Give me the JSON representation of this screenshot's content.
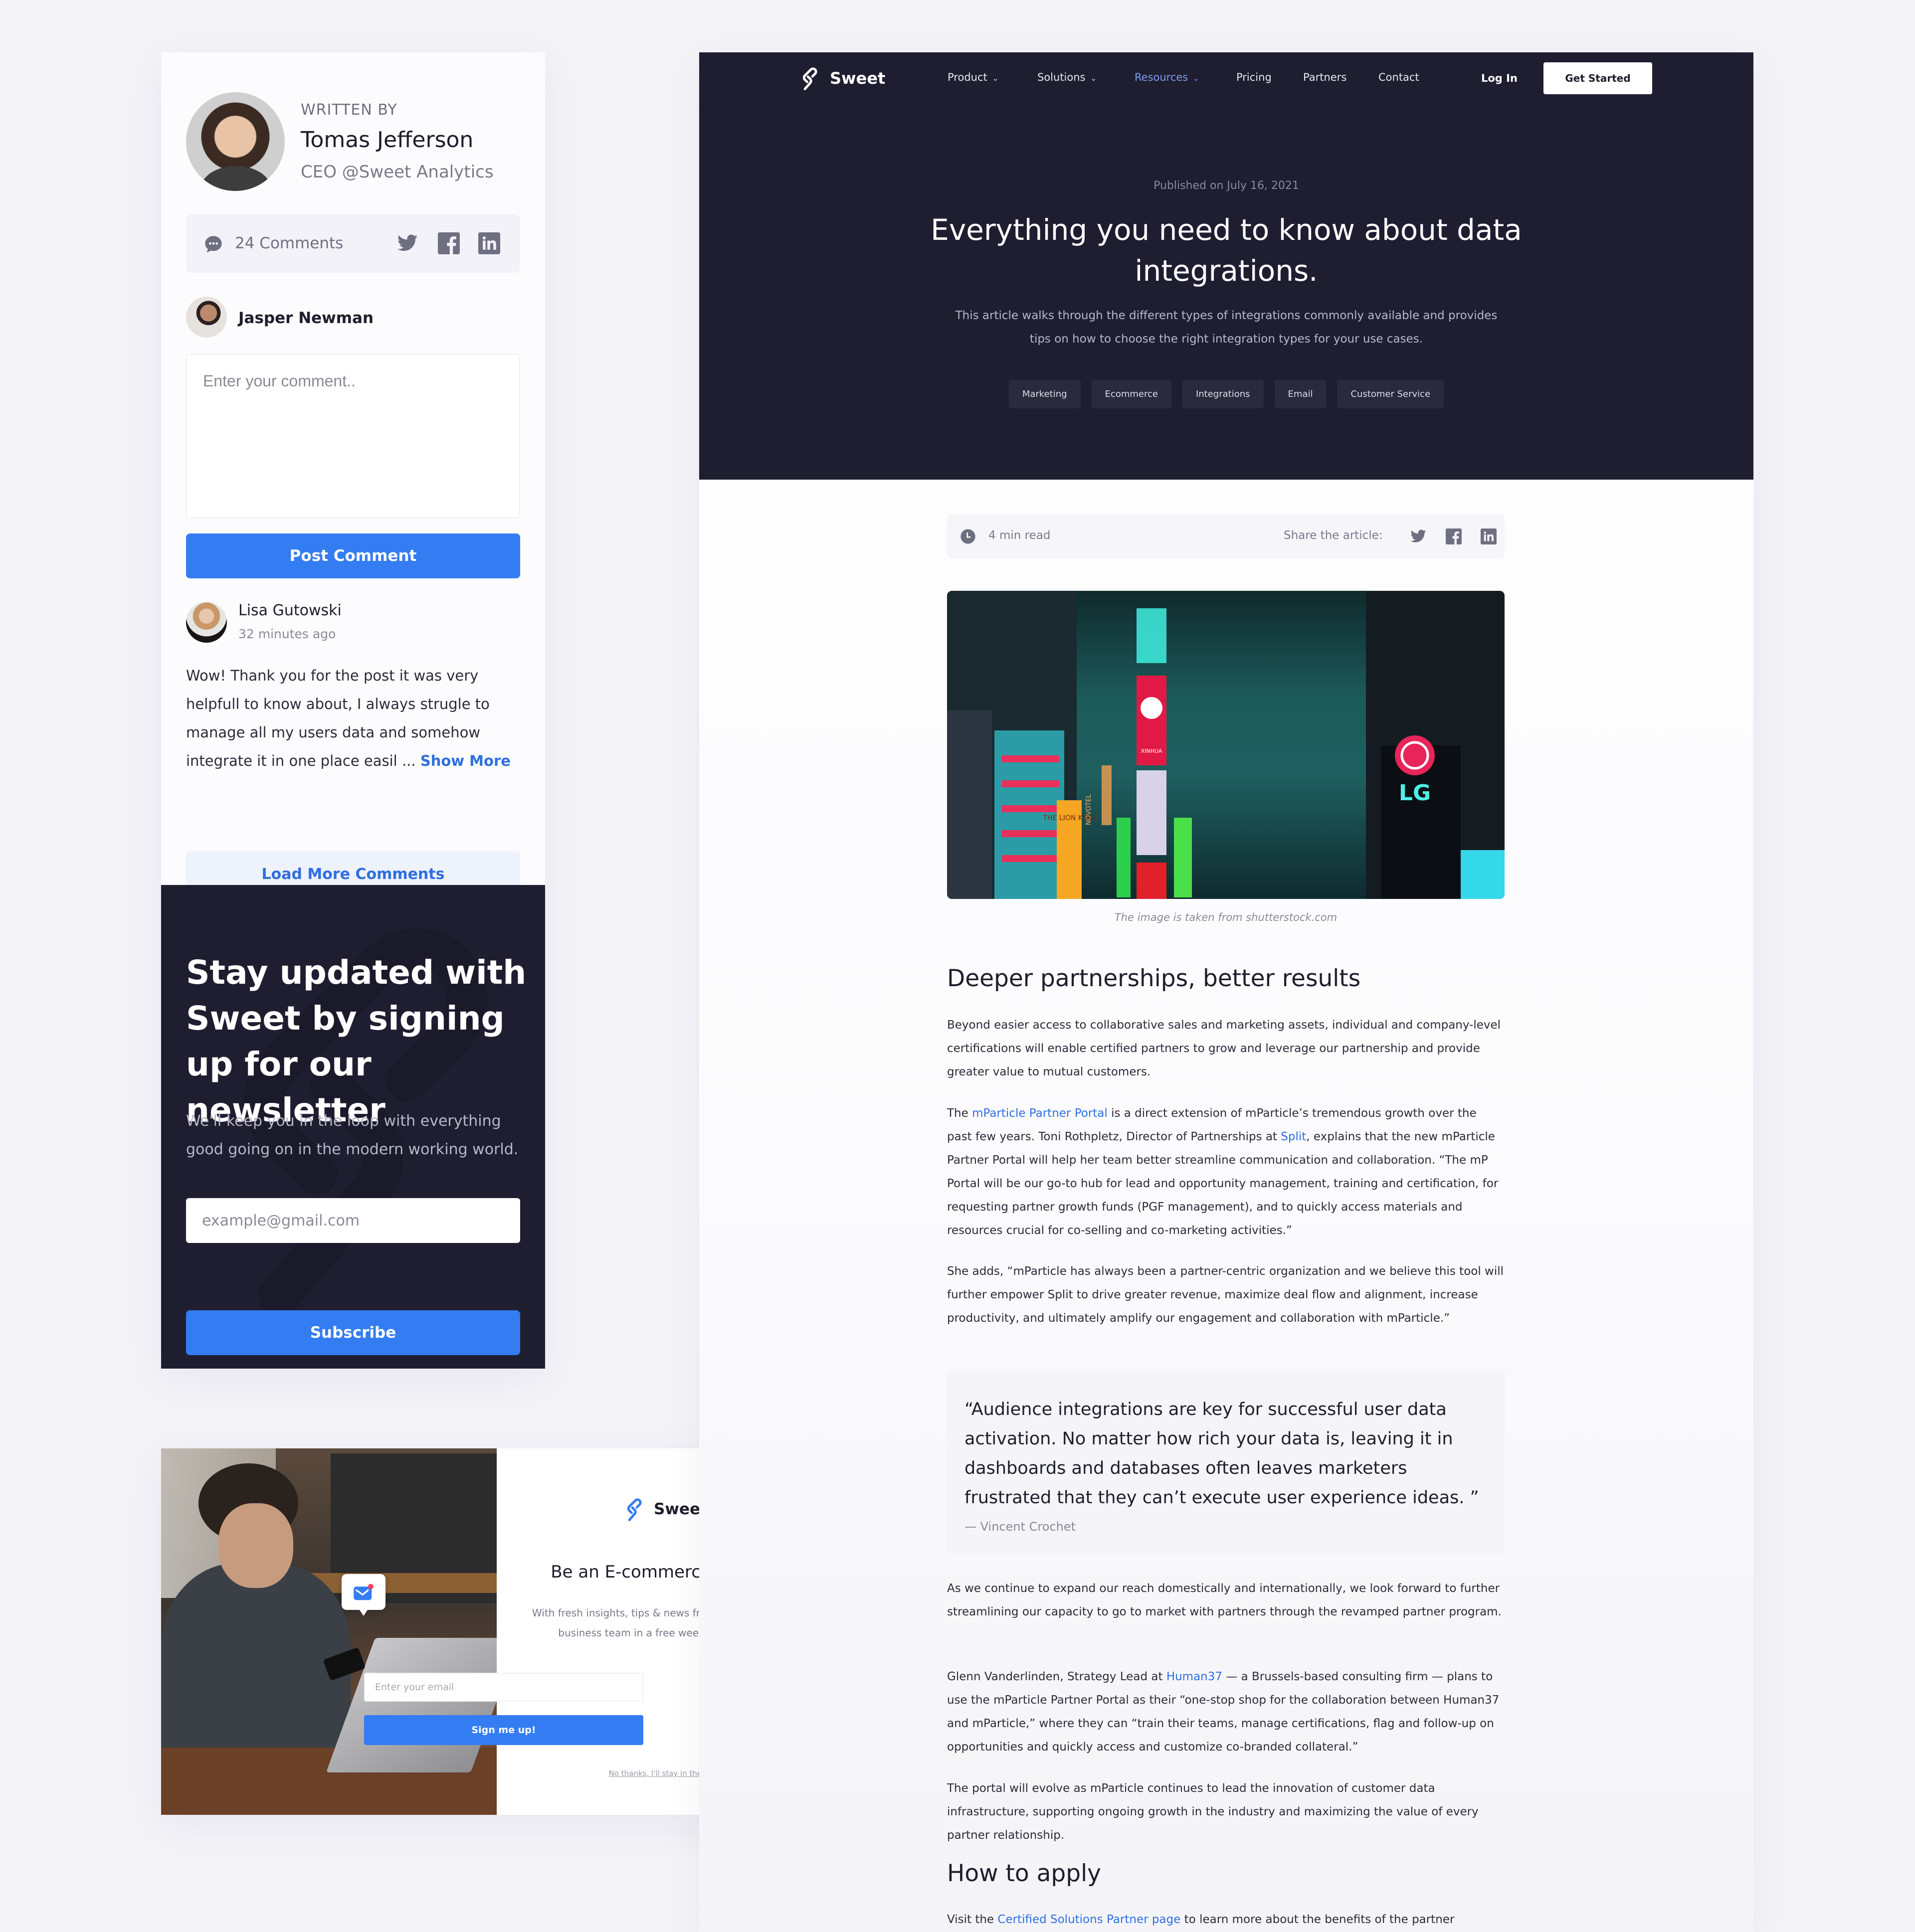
{
  "author_card": {
    "written_by_label": "WRITTEN BY",
    "name": "Tomas Jefferson",
    "role": "CEO @Sweet Analytics",
    "comments_count_label": "24 Comments",
    "social_icons": [
      "twitter-icon",
      "facebook-icon",
      "linkedin-icon"
    ]
  },
  "comment_form": {
    "current_user": "Jasper Newman",
    "placeholder": "Enter your comment..",
    "value": "",
    "submit_label": "Post Comment"
  },
  "comments": [
    {
      "author": "Lisa Gutowski",
      "time": "32 minutes ago",
      "text": "Wow! Thank you for the post it was very helpfull to know about, I always strugle to manage all my users data and somehow integrate it in one place easil ...",
      "show_more_label": "Show More"
    }
  ],
  "load_more_label": "Load More Comments",
  "newsletter": {
    "title": "Stay updated with Sweet by signing up for our newsletter",
    "description": "We'll keep you in the loop with everything good going on in the modern working world.",
    "email_placeholder": "example@gmail.com",
    "email_value": "",
    "button_label": "Subscribe"
  },
  "popup": {
    "close_label": "×",
    "brand": "Sweet",
    "title": "Be an E-commerce Expert!",
    "description": "With fresh insights, tips & news from our ecommerce business team in a free weekly newsletter.",
    "email_placeholder": "Enter your email",
    "email_value": "",
    "button_label": "Sign me up!",
    "decline_label": "No thanks, I'll stay in the dark"
  },
  "nav": {
    "brand": "Sweet",
    "items": [
      {
        "label": "Product",
        "has_dropdown": true,
        "active": false
      },
      {
        "label": "Solutions",
        "has_dropdown": true,
        "active": false
      },
      {
        "label": "Resources",
        "has_dropdown": true,
        "active": true
      },
      {
        "label": "Pricing",
        "has_dropdown": false,
        "active": false
      },
      {
        "label": "Partners",
        "has_dropdown": false,
        "active": false
      },
      {
        "label": "Contact",
        "has_dropdown": false,
        "active": false
      }
    ],
    "login_label": "Log In",
    "cta_label": "Get Started"
  },
  "article": {
    "published": "Published on July 16, 2021",
    "title": "Everything you need to know about data integrations.",
    "subtitle": "This article walks through the different types of integrations commonly available and provides tips on how to choose the right integration types for your use cases.",
    "tags": [
      "Marketing",
      "Ecommerce",
      "Integrations",
      "Email",
      "Customer Service"
    ],
    "read_time": "4 min read",
    "share_label": "Share the article:",
    "image_caption": "The image is taken from shutterstock.com",
    "image_signs": {
      "lg": "LG",
      "xinhua": "XINHUA",
      "novotel": "NOVOTEL",
      "lion_king": "THE LION KING"
    },
    "section1_heading": "Deeper partnerships, better results",
    "p1": "Beyond easier access to collaborative sales and marketing assets, individual and company-level certifications will enable certified partners to grow and leverage our partnership and provide greater value to mutual customers.",
    "p2": {
      "before": "The ",
      "link1": "mParticle Partner Portal",
      "middle": " is a direct extension of mParticle’s tremendous growth over the past few years. Toni Rothpletz, Director of Partnerships at ",
      "link2": "Split",
      "after": ", explains that the new mParticle Partner Portal will help her team better streamline communication and collaboration. “The mP Portal will be our go-to hub for lead and opportunity management, training and certification, for requesting partner growth funds (PGF management), and to quickly access materials and resources crucial for co-selling and co-marketing activities.”"
    },
    "p3": "She adds, “mParticle has always been a partner-centric organization and we believe this tool will further empower Split to drive greater revenue, maximize deal flow and alignment, increase productivity, and ultimately amplify our engagement and collaboration with mParticle.”",
    "quote": "“Audience integrations are key for successful user data activation. No matter how rich your data is, leaving it in dashboards and databases often leaves marketers frustrated that they can’t execute user experience ideas. ”",
    "quote_author": "— Vincent Crochet",
    "p4": "As we continue to expand our reach domestically and internationally, we look forward to further streamlining our capacity to go to market with partners through the revamped partner program.",
    "p5": {
      "before": "Glenn Vanderlinden, Strategy Lead at ",
      "link": "Human37",
      "after": " — a Brussels-based consulting firm — plans to use the mParticle Partner Portal as their “one-stop shop for the collaboration between Human37 and mParticle,” where they can “train their teams, manage certifications, flag and follow-up on opportunities and quickly access and customize co-branded collateral.”"
    },
    "p6": "The portal will evolve as mParticle continues to lead the innovation of customer data infrastructure, supporting ongoing growth in the industry and maximizing the value of every partner relationship.",
    "section2_heading": "How to apply",
    "p7": {
      "before": "Visit the ",
      "link": "Certified Solutions Partner page",
      "after": " to learn more about the benefits of the partner"
    }
  },
  "colors": {
    "accent": "#347cf1",
    "link": "#2f6fe0",
    "dark": "#1f1e31",
    "page_bg": "#f3f3f8"
  }
}
